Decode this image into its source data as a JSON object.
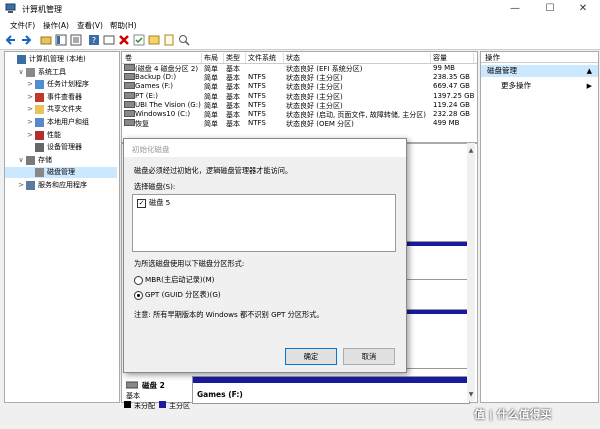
{
  "window": {
    "title": "计算机管理",
    "minimize": "—",
    "maximize": "☐",
    "close": "✕"
  },
  "menu": [
    "文件(F)",
    "操作(A)",
    "查看(V)",
    "帮助(H)"
  ],
  "tree": [
    {
      "label": "计算机管理 (本地)",
      "level": 0,
      "exp": "",
      "icon": "computer-icon"
    },
    {
      "label": "系统工具",
      "level": 1,
      "exp": "∨",
      "icon": "tools-icon"
    },
    {
      "label": "任务计划程序",
      "level": 2,
      "exp": ">",
      "icon": "clock-icon"
    },
    {
      "label": "事件查看器",
      "level": 2,
      "exp": ">",
      "icon": "event-icon"
    },
    {
      "label": "共享文件夹",
      "level": 2,
      "exp": ">",
      "icon": "folder-icon"
    },
    {
      "label": "本地用户和组",
      "level": 2,
      "exp": ">",
      "icon": "users-icon"
    },
    {
      "label": "性能",
      "level": 2,
      "exp": ">",
      "icon": "perf-icon"
    },
    {
      "label": "设备管理器",
      "level": 2,
      "exp": "",
      "icon": "device-icon"
    },
    {
      "label": "存储",
      "level": 1,
      "exp": "∨",
      "icon": "storage-icon"
    },
    {
      "label": "磁盘管理",
      "level": 2,
      "exp": "",
      "icon": "disk-icon",
      "selected": true
    },
    {
      "label": "服务和应用程序",
      "level": 1,
      "exp": ">",
      "icon": "services-icon"
    }
  ],
  "table": {
    "headers": [
      "卷",
      "布局",
      "类型",
      "文件系统",
      "状态",
      "容量"
    ],
    "rows": [
      [
        "(磁盘 4 磁盘分区 2)",
        "简单",
        "基本",
        "",
        "状态良好 (EFI 系统分区)",
        "99 MB"
      ],
      [
        "Backup (D:)",
        "简单",
        "基本",
        "NTFS",
        "状态良好 (主分区)",
        "238.35 GB"
      ],
      [
        "Games (F:)",
        "简单",
        "基本",
        "NTFS",
        "状态良好 (主分区)",
        "669.47 GB"
      ],
      [
        "PT (E:)",
        "简单",
        "基本",
        "NTFS",
        "状态良好 (主分区)",
        "1397.25 GB"
      ],
      [
        "UBI The Vision (G:)",
        "简单",
        "基本",
        "NTFS",
        "状态良好 (主分区)",
        "119.24 GB"
      ],
      [
        "Windows10 (C:)",
        "简单",
        "基本",
        "NTFS",
        "状态良好 (启动, 页面文件, 故障转储, 主分区)",
        "232.28 GB"
      ],
      [
        "恢复",
        "简单",
        "基本",
        "NTFS",
        "状态良好 (OEM 分区)",
        "499 MB"
      ]
    ]
  },
  "actions": {
    "header": "操作",
    "selected": "磁盘管理",
    "more": "更多操作"
  },
  "disk2": {
    "name": "磁盘 2",
    "type": "基本",
    "volume": "Games (F:)"
  },
  "legend": {
    "unallocated": "未分配",
    "primary": "主分区"
  },
  "dialog": {
    "title": "初始化磁盘",
    "message": "磁盘必须经过初始化，逻辑磁盘管理器才能访问。",
    "select_label": "选择磁盘(S):",
    "disk_item": "磁盘 5",
    "style_label": "为所选磁盘使用以下磁盘分区形式:",
    "mbr": "MBR(主启动记录)(M)",
    "gpt": "GPT (GUID 分区表)(G)",
    "note": "注意: 所有早期版本的 Windows 都不识别 GPT 分区形式。",
    "ok": "确定",
    "cancel": "取消"
  },
  "watermark": "值 | 什么值得买",
  "colors": {
    "primary_bar": "#1a1aa0",
    "selection": "#cce8ff",
    "accent": "#0078d7"
  }
}
